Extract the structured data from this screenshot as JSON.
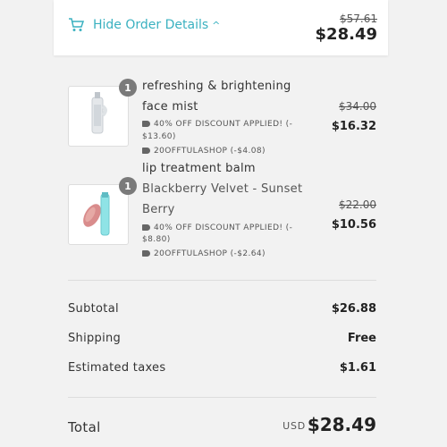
{
  "header": {
    "toggle_label": "Hide Order Details",
    "original_total": "$57.61",
    "total": "$28.49"
  },
  "items": [
    {
      "quantity": "1",
      "title_line1": "refreshing & brightening",
      "title_line2": "face mist",
      "discount1_line1": "40% OFF DISCOUNT APPLIED! (-",
      "discount1_line2": "$13.60)",
      "discount2": "20OFFTULASHOP (-$4.08)",
      "original_price": "$34.00",
      "price": "$16.32"
    },
    {
      "quantity": "1",
      "title_line1": "lip treatment balm",
      "variant_line1": "Blackberry Velvet - Sunset",
      "variant_line2": "Berry",
      "discount1_line1": "40% OFF DISCOUNT APPLIED! (-",
      "discount1_line2": "$8.80)",
      "discount2": "20OFFTULASHOP (-$2.64)",
      "original_price": "$22.00",
      "price": "$10.56"
    }
  ],
  "summary": {
    "subtotal_label": "Subtotal",
    "subtotal": "$26.88",
    "shipping_label": "Shipping",
    "shipping": "Free",
    "taxes_label": "Estimated taxes",
    "taxes": "$1.61",
    "total_label": "Total",
    "currency": "USD",
    "total": "$28.49"
  },
  "colors": {
    "accent": "#3ab1c0",
    "background": "#f2f2f2"
  }
}
